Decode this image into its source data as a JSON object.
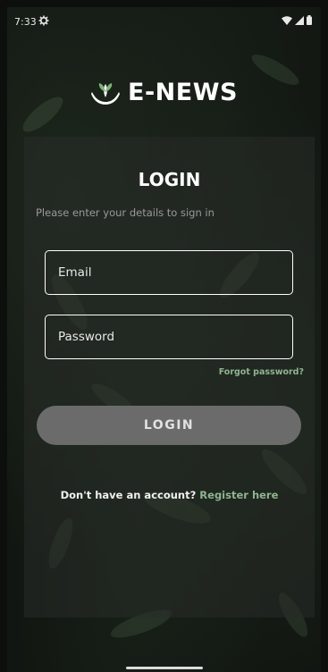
{
  "status_bar": {
    "time": "7:33",
    "settings_icon": "gear-icon",
    "wifi_icon": "wifi-icon",
    "signal_icon": "signal-icon",
    "battery_icon": "battery-icon"
  },
  "brand": {
    "name": "E-NEWS",
    "logo_icon": "plant-hands-logo"
  },
  "login": {
    "title": "LOGIN",
    "subtitle": "Please enter your details to sign in",
    "email_placeholder": "Email",
    "password_placeholder": "Password",
    "forgot_label": "Forgot password?",
    "button_label": "LOGIN",
    "register_prompt": "Don't have an account?",
    "register_link": "Register here"
  },
  "colors": {
    "accent": "#8fb58f",
    "button": "#6b6b6b",
    "background": "#111511"
  }
}
